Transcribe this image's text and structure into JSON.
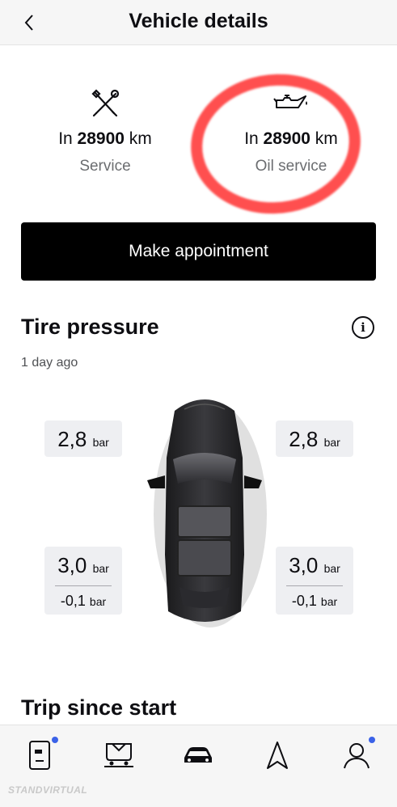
{
  "header": {
    "title": "Vehicle details",
    "back_icon": "chevron-left-icon"
  },
  "services": [
    {
      "icon": "wrench-screwdriver-icon",
      "prefix": "In",
      "distance": "28900",
      "unit": "km",
      "label": "Service"
    },
    {
      "icon": "oil-can-icon",
      "prefix": "In",
      "distance": "28900",
      "unit": "km",
      "label": "Oil service"
    }
  ],
  "appointment": {
    "label": "Make appointment"
  },
  "tire_pressure": {
    "title": "Tire pressure",
    "updated": "1 day ago",
    "unit": "bar",
    "front_left": {
      "value": "2,8"
    },
    "front_right": {
      "value": "2,8"
    },
    "rear_left": {
      "value": "3,0",
      "delta": "-0,1"
    },
    "rear_right": {
      "value": "3,0",
      "delta": "-0,1"
    }
  },
  "trip": {
    "title": "Trip since start"
  },
  "nav": {
    "items": [
      {
        "icon": "key-card-icon",
        "badge": true
      },
      {
        "icon": "car-lift-icon",
        "badge": false
      },
      {
        "icon": "car-front-icon",
        "badge": false,
        "active": true
      },
      {
        "icon": "navigation-arrow-icon",
        "badge": false
      },
      {
        "icon": "user-profile-icon",
        "badge": true
      }
    ]
  },
  "watermark": {
    "text": "STANDVIRTUAL"
  },
  "colors": {
    "accent_red": "#ff2828",
    "badge_blue": "#3b62e8",
    "button_bg": "#000000"
  }
}
